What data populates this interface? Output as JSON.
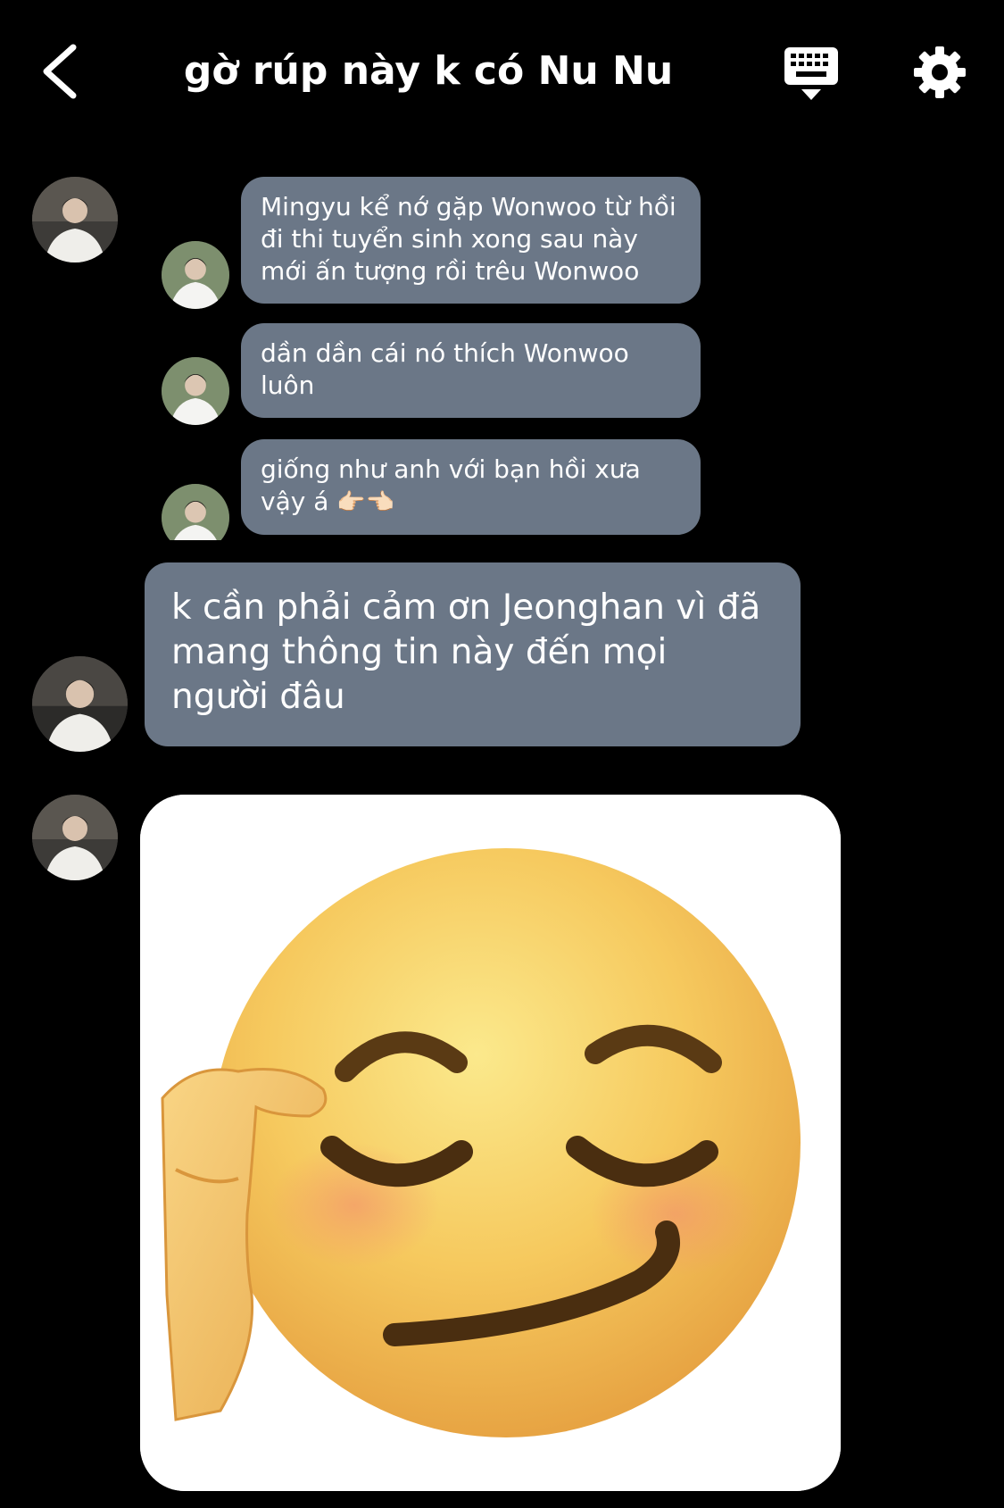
{
  "header": {
    "title": "gờ rúp này k có Nu Nu",
    "back_icon": "chevron-left-icon",
    "keyboard_icon": "keyboard-icon",
    "settings_icon": "gear-icon"
  },
  "quoted_messages": [
    {
      "text": "Mingyu kể nớ gặp Wonwoo từ hồi đi thi tuyển sinh xong sau này mới ấn tượng rồi trêu Wonwoo"
    },
    {
      "text": "dần dần cái nó thích Wonwoo luôn"
    },
    {
      "text": "giống như anh với bạn hồi xưa vậy á",
      "emojis": "👉🏻👈🏻"
    }
  ],
  "messages": [
    {
      "text": "k cần phải cảm ơn Jeonghan vì đã mang thông tin này đến mọi người đâu"
    }
  ],
  "sticker": {
    "icon": "smirking-face-sticker"
  },
  "colors": {
    "background": "#000000",
    "bubble": "#6b7787",
    "text": "#ffffff"
  }
}
